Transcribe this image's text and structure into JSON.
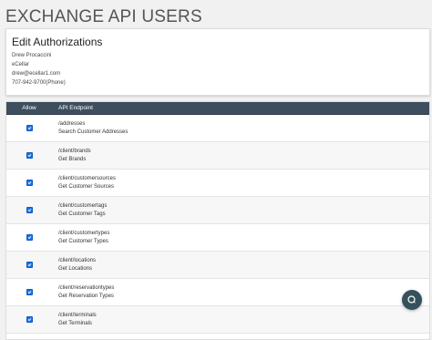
{
  "page": {
    "title": "EXCHANGE API USERS"
  },
  "card": {
    "title": "Edit Authorizations",
    "name": "Drew Procaccini",
    "company": "eCellar",
    "email": "drew@ecellar1.com",
    "phone": "707-942-9700(Phone)"
  },
  "table": {
    "headers": {
      "allow": "Allow",
      "endpoint": "API Endpoint"
    },
    "rows": [
      {
        "path": "/addresses",
        "desc": "Search Customer Addresses",
        "checked": true
      },
      {
        "path": "/client/brands",
        "desc": "Get Brands",
        "checked": true
      },
      {
        "path": "/client/customersources",
        "desc": "Get Customer Sources",
        "checked": true
      },
      {
        "path": "/client/customertags",
        "desc": "Get Customer Tags",
        "checked": true
      },
      {
        "path": "/client/customertypes",
        "desc": "Get Customer Types",
        "checked": true
      },
      {
        "path": "/client/locations",
        "desc": "Get Locations",
        "checked": true
      },
      {
        "path": "/client/reservationtypes",
        "desc": "Get Reservation Types",
        "checked": true
      },
      {
        "path": "/client/terminals",
        "desc": "Get Terminals",
        "checked": true
      }
    ]
  },
  "icons": {
    "chat": "chat-bubble-icon",
    "check": "checkmark-icon"
  },
  "colors": {
    "header_bg": "#3d4e5e",
    "checkbox": "#1a73e8",
    "chat_button": "#36515c"
  }
}
